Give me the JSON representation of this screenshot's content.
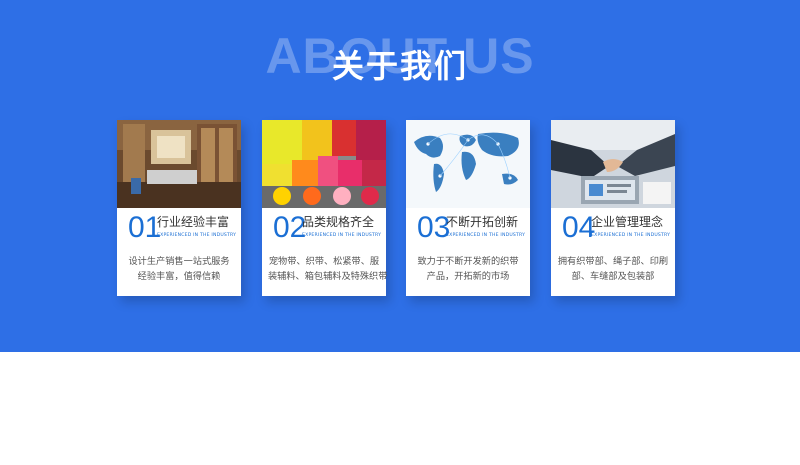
{
  "header": {
    "background_text": "ABOUT US",
    "title": "关于我们"
  },
  "colors": {
    "section_bg": "#2e6fe6",
    "accent_blue": "#1b6fd4",
    "card_bg": "#ffffff"
  },
  "cards": [
    {
      "number": "01",
      "title": "行业经验丰富",
      "subtitle": "EXPERIENCED IN THE INDUSTRY",
      "lines": [
        "设计生产销售一站式服务",
        "经验丰富，值得信赖"
      ],
      "photo": "office-interior-photo"
    },
    {
      "number": "02",
      "title": "品类规格齐全",
      "subtitle": "EXPERIENCED IN THE INDUSTRY",
      "lines": [
        "宠物带、织带、松紧带、服",
        "装辅料、箱包辅料及特殊织带"
      ],
      "photo": "webbing-rolls-photo"
    },
    {
      "number": "03",
      "title": "不断开拓创新",
      "subtitle": "EXPERIENCED IN THE INDUSTRY",
      "lines": [
        "致力于不断开发新的织带",
        "产品，开拓新的市场"
      ],
      "photo": "world-map-photo"
    },
    {
      "number": "04",
      "title": "企业管理理念",
      "subtitle": "EXPERIENCED IN THE INDUSTRY",
      "lines": [
        "拥有织带部、绳子部、印刷",
        "部、车缝部及包装部"
      ],
      "photo": "handshake-photo"
    }
  ]
}
